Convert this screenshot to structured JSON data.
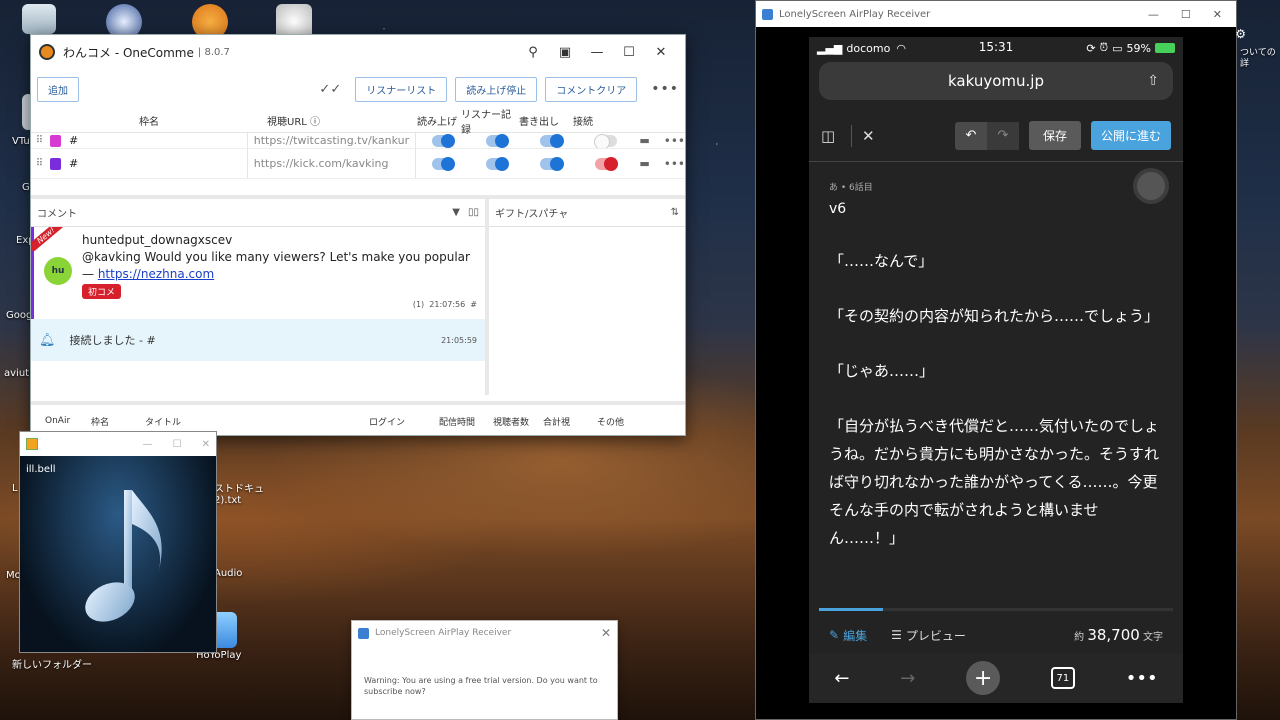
{
  "desktop": {
    "icons": [
      {
        "label": "VTu"
      },
      {
        "label": "G"
      },
      {
        "label": "Exp"
      },
      {
        "label": "Goog"
      },
      {
        "label": "aviutl.e"
      },
      {
        "label": "L"
      },
      {
        "label": "Mo"
      },
      {
        "label": "新しいフォルダー"
      },
      {
        "label": "HoYoPlay"
      },
      {
        "label": "Audio"
      }
    ],
    "partial_text_file": "ストドキュ\n2).txt",
    "right_edge_text": "ついての\n詳"
  },
  "onecomme": {
    "title": "わんコメ - OneComme",
    "version": "8.0.7",
    "add_button": "追加",
    "listener_list_button": "リスナーリスト",
    "stop_reading_button": "読み上げ停止",
    "clear_comments_button": "コメントクリア",
    "columns": {
      "frame_name": "枠名",
      "url": "視聴URL",
      "read_aloud": "読み上げ",
      "listener_record": "リスナー記録",
      "write_out": "書き出し",
      "connect": "接続"
    },
    "rows": [
      {
        "name": "#",
        "url": "https://twitcasting.tv/kankur",
        "color": "#d63ad0"
      },
      {
        "name": "#",
        "url": "https://kick.com/kavking",
        "color": "#7a2ddb"
      }
    ],
    "comment_panel_title": "コメント",
    "gift_panel_title": "ギフト/スパチャ",
    "comment": {
      "ribbon": "New!",
      "avatar": "hu",
      "user": "huntedput_downagxscev",
      "text": "@kavking Would you like many viewers? Let's make you popular",
      "link_prefix": "— ",
      "link": "https://nezhna.com",
      "badge": "初コメ",
      "count": "(1)",
      "time": "21:07:56",
      "frame": "#"
    },
    "system_message": {
      "text": "接続しました - #",
      "time": "21:05:59"
    },
    "bottom_columns": {
      "onair": "OnAir",
      "frame_name": "枠名",
      "title": "タイトル",
      "login": "ログイン",
      "duration": "配信時間",
      "viewers": "視聴者数",
      "total": "合計視",
      "other": "その他"
    }
  },
  "player": {
    "track_name": "ill.bell"
  },
  "trial_dialog": {
    "title": "LonelyScreen AirPlay Receiver",
    "message": "Warning: You are using a free trial version. Do you want to subscribe now?"
  },
  "lonelyscreen": {
    "title": "LonelyScreen AirPlay Receiver",
    "phone": {
      "carrier": "docomo",
      "time": "15:31",
      "battery": "59%",
      "url": "kakuyomu.jp",
      "save_button": "保存",
      "publish_button": "公開に進む",
      "episode_crumb": "あ • 6話目",
      "episode_title": "v6",
      "body": [
        "「……なんで」",
        "「その契約の内容が知られたから……でしょう」",
        "「じゃあ……」",
        "「自分が払うべき代償だと……気付いたのでしょうね。だから貴方にも明かさなかった。そうすれば守り切れなかった誰かがやってくる……。今更そんな手の内で転がされようと構いません……！」"
      ],
      "edit_tab": "編集",
      "preview_tab": "プレビュー",
      "char_prefix": "約",
      "char_count": "38,700",
      "char_unit": "文字",
      "tab_count": "71",
      "scroll_progress": 0.18
    }
  },
  "colors": {
    "accent_blue": "#1e74d6",
    "connect_red": "#d6202b",
    "kakuyomu_blue": "#4aa3dd"
  }
}
